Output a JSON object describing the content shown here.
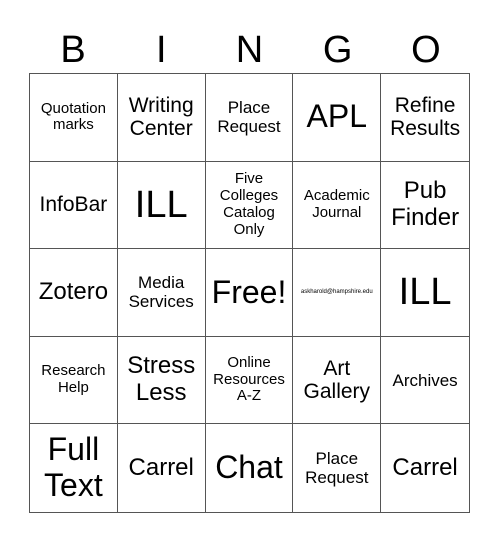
{
  "header": {
    "letters": [
      "B",
      "I",
      "N",
      "G",
      "O"
    ]
  },
  "cells": [
    "Quotation marks",
    "Writing Center",
    "Place Request",
    "APL",
    "Refine Results",
    "InfoBar",
    "ILL",
    "Five Colleges Catalog Only",
    "Academic Journal",
    "Pub Finder",
    "Zotero",
    "Media Services",
    "Free!",
    "askharold@hampshire.edu",
    "ILL",
    "Research Help",
    "Stress Less",
    "Online Resources A-Z",
    "Art Gallery",
    "Archives",
    "Full Text",
    "Carrel",
    "Chat",
    "Place Request",
    "Carrel"
  ]
}
